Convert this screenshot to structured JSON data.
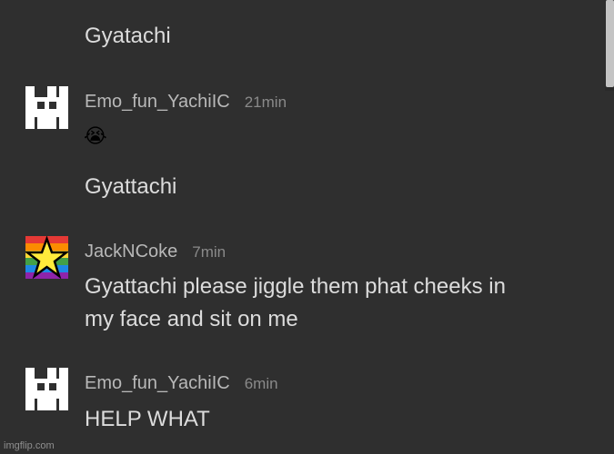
{
  "chat": {
    "previous_message": "Gyatachi",
    "messages": [
      {
        "username": "Emo_fun_YachiIC",
        "time": "21min",
        "emoji": "😭",
        "text": "Gyattachi"
      },
      {
        "username": "JackNCoke",
        "time": "7min",
        "text_line1": "Gyattachi please jiggle them phat cheeks in",
        "text_line2": "my face and sit on me"
      },
      {
        "username": "Emo_fun_YachiIC",
        "time": "6min",
        "text": "HELP WHAT"
      }
    ]
  },
  "icons": {
    "avatar_1": "pixel-avatar-icon",
    "avatar_2": "rainbow-star-avatar-icon",
    "avatar_3": "pixel-avatar-icon"
  },
  "watermark": "imgflip.com",
  "colors": {
    "background": "#2f2f2f",
    "text": "#dcdcdc",
    "username": "#b8b8b8",
    "timestamp": "#8a8a8a"
  }
}
